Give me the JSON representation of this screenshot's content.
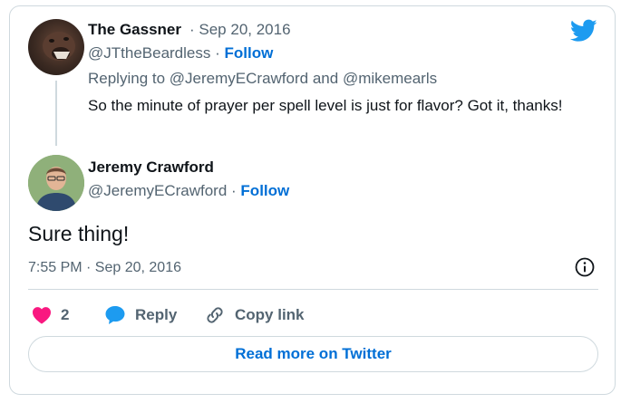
{
  "quoted_tweet": {
    "author_name": "The Gassner",
    "date": "Sep 20, 2016",
    "handle": "@JTtheBeardless",
    "follow_label": "Follow",
    "replying_prefix": "Replying to",
    "replying_user_1": "@JeremyECrawford",
    "replying_conjunction": "and",
    "replying_user_2": "@mikemearls",
    "text": "So the minute of prayer per spell level is just for flavor? Got it, thanks!"
  },
  "main_tweet": {
    "author_name": "Jeremy Crawford",
    "handle": "@JeremyECrawford",
    "follow_label": "Follow",
    "text": "Sure thing!",
    "timestamp": "7:55 PM · Sep 20, 2016"
  },
  "actions": {
    "like_count": "2",
    "reply_label": "Reply",
    "copy_link_label": "Copy link"
  },
  "read_more_label": "Read more on Twitter",
  "icons": {
    "brand": "twitter-bird-icon",
    "like": "heart-icon",
    "reply": "speech-bubble-icon",
    "copy": "link-icon",
    "info": "info-icon"
  },
  "colors": {
    "brand": "#1d9bf0",
    "follow": "#006fd6",
    "like": "#f91880",
    "muted": "#536471"
  }
}
